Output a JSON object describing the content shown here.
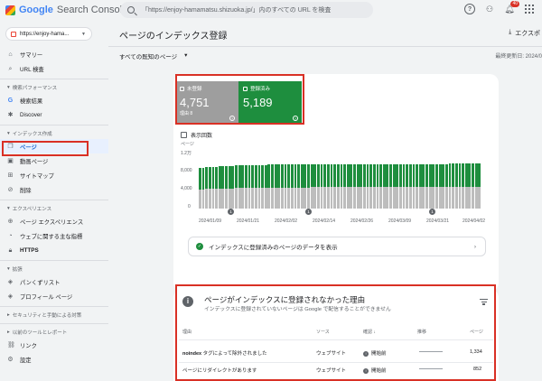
{
  "app": {
    "brand_g": "Google",
    "brand_rest": "Search Console"
  },
  "search": {
    "placeholder": "「https://enjoy-hamamatsu.shizuoka.jp/」内のすべての URL を検査"
  },
  "topbar": {
    "notifications": "40"
  },
  "property": {
    "label": "https://enjoy-hama..."
  },
  "sidebar": {
    "items_top": [
      {
        "label": "サマリー",
        "icon": "home-icon"
      },
      {
        "label": "URL 検査",
        "icon": "search-icon"
      }
    ],
    "sec_perf": "検索パフォーマンス",
    "perf": [
      {
        "label": "検索結果",
        "icon": "google-g-icon"
      },
      {
        "label": "Discover",
        "icon": "asterisk-icon"
      }
    ],
    "sec_index": "インデックス作成",
    "index": [
      {
        "label": "ページ",
        "icon": "pages-icon"
      },
      {
        "label": "動画ページ",
        "icon": "video-icon"
      },
      {
        "label": "サイトマップ",
        "icon": "sitemap-icon"
      },
      {
        "label": "削除",
        "icon": "remove-icon"
      }
    ],
    "sec_exp": "エクスペリエンス",
    "exp": [
      {
        "label": "ページ エクスペリエンス",
        "icon": "plus-circle-icon"
      },
      {
        "label": "ウェブに関する主な指標",
        "icon": "gauge-icon"
      },
      {
        "label": "HTTPS",
        "icon": "lock-icon"
      }
    ],
    "sec_ext": "拡張",
    "ext": [
      {
        "label": "パンくずリスト",
        "icon": "layers-icon"
      },
      {
        "label": "プロフィール ページ",
        "icon": "layers-icon"
      }
    ],
    "sec_sec": "セキュリティと手動による対策",
    "sec_old": "以前のツールとレポート",
    "bottom": [
      {
        "label": "リンク",
        "icon": "link-icon"
      },
      {
        "label": "設定",
        "icon": "gear-icon"
      }
    ]
  },
  "main": {
    "title": "ページのインデックス登録",
    "export": "エクスポ",
    "filter": "すべての既知のページ",
    "updated": "最終更新日: 2024/0"
  },
  "tiles": {
    "not_indexed": {
      "label": "未登録",
      "value": "4,751",
      "sub": "理由 8"
    },
    "indexed": {
      "label": "登録済み",
      "value": "5,189"
    }
  },
  "impressions_label": "表示回数",
  "chart_data": {
    "type": "bar",
    "stacked": true,
    "ylabel": "ページ",
    "ylim": [
      0,
      12000
    ],
    "yticks": [
      "1.2万",
      "8,000",
      "4,000",
      "0"
    ],
    "xticks": [
      "2024/01/09",
      "2024/01/21",
      "2024/02/02",
      "2024/02/14",
      "2024/02/26",
      "2024/03/09",
      "2024/03/21",
      "2024/04/02"
    ],
    "series": [
      {
        "color": "#bdbdbd",
        "values": [
          4300,
          4300,
          4350,
          4350,
          4400,
          4400,
          4450,
          4450,
          4500,
          4500,
          4500,
          4550,
          4550,
          4550,
          4600,
          4600,
          4600,
          4600,
          4650,
          4650,
          4650,
          4650,
          4650,
          4700,
          4700,
          4700,
          4700,
          4700,
          4700,
          4700,
          4700,
          4700,
          4700,
          4700,
          4750,
          4750,
          4750,
          4750,
          4750,
          4750,
          4750,
          4750,
          4750,
          4750,
          4750,
          4750,
          4750,
          4750,
          4750,
          4750,
          4750,
          4750,
          4750,
          4750,
          4750,
          4750,
          4750,
          4750,
          4750,
          4750,
          4750,
          4750,
          4750,
          4750,
          4750,
          4750,
          4750,
          4750,
          4750,
          4750,
          4750,
          4750,
          4750,
          4750,
          4750,
          4750,
          4751,
          4751,
          4751,
          4751,
          4751,
          4751,
          4751,
          4751,
          4751,
          4751
        ]
      },
      {
        "color": "#1e8e3e",
        "values": [
          4800,
          4800,
          4850,
          4850,
          4900,
          4900,
          4900,
          4950,
          4950,
          4950,
          4950,
          5000,
          5000,
          5000,
          5000,
          5000,
          5050,
          5050,
          5050,
          5050,
          5050,
          5100,
          5100,
          5100,
          5100,
          5100,
          5100,
          5100,
          5100,
          5100,
          5150,
          5150,
          5150,
          5150,
          5150,
          5150,
          5150,
          5150,
          5150,
          5150,
          5150,
          5150,
          5150,
          5150,
          5150,
          5150,
          5150,
          5150,
          5150,
          5150,
          5150,
          5150,
          5150,
          5150,
          5150,
          5150,
          5150,
          5150,
          5150,
          5150,
          5150,
          5150,
          5150,
          5150,
          5150,
          5150,
          5150,
          5150,
          5150,
          5150,
          5150,
          5150,
          5150,
          5150,
          5150,
          5150,
          5189,
          5189,
          5189,
          5189,
          5189,
          5189,
          5189,
          5189,
          5189,
          5189
        ]
      }
    ],
    "annotations": [
      "1",
      "1",
      "1"
    ]
  },
  "link_row": "インデックスに登録済みのページのデータを表示",
  "reasons": {
    "title": "ページがインデックスに登録されなかった理由",
    "subtitle": "インデックスに登録されていないページは Google で配信することができません",
    "headers": [
      "理由",
      "ソース",
      "確認",
      "推移",
      "ページ"
    ],
    "rows": [
      {
        "reason_bold": "noindex",
        "reason": " タグによって除外されました",
        "source": "ウェブサイト",
        "status": "開始前",
        "pages": "1,334"
      },
      {
        "reason_bold": "",
        "reason": "ページにリダイレクトがあります",
        "source": "ウェブサイト",
        "status": "開始前",
        "pages": "852"
      }
    ]
  }
}
